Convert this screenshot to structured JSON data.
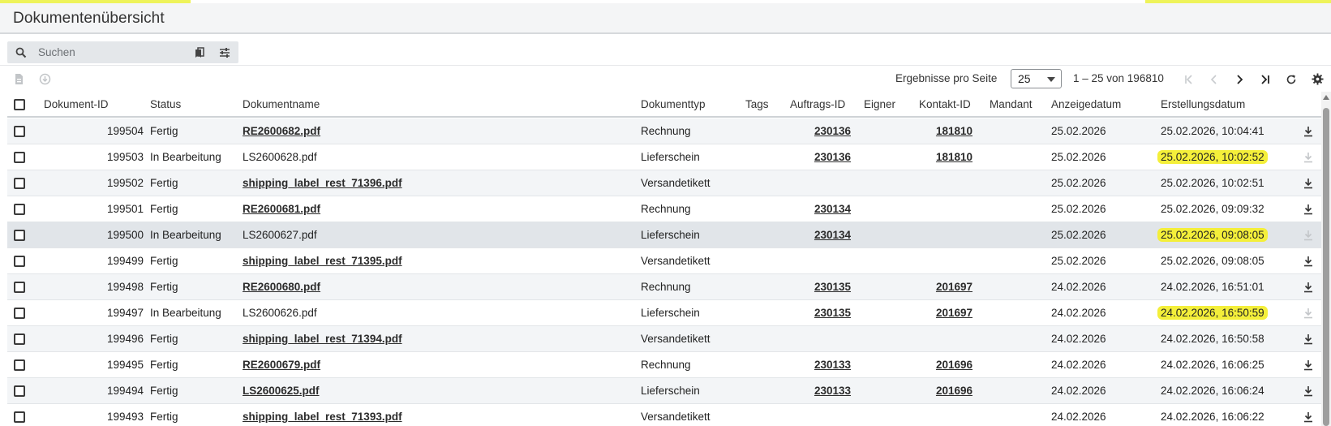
{
  "app": {
    "title": "Dokumentenübersicht",
    "accent_color": "#eef35a"
  },
  "search": {
    "placeholder": "Suchen"
  },
  "toolbar": {
    "icons": [
      "document-icon",
      "circle-arrow-icon",
      "search-icon",
      "bookmarks-icon",
      "filter-settings-icon"
    ]
  },
  "pager": {
    "per_page_label": "Ergebnisse pro Seite",
    "per_page_value": "25",
    "range": "1 – 25 von 196810"
  },
  "table": {
    "headers": {
      "id": "Dokument-ID",
      "status": "Status",
      "name": "Dokumentname",
      "type": "Dokumenttyp",
      "tags": "Tags",
      "order": "Auftrags-ID",
      "owner": "Eigner",
      "contact": "Kontakt-ID",
      "client": "Mandant",
      "display_date": "Anzeigedatum",
      "created": "Erstellungsdatum"
    },
    "rows": [
      {
        "id": "199504",
        "status": "Fertig",
        "name": "RE2600682.pdf",
        "name_link": true,
        "type": "Rechnung",
        "order": "230136",
        "contact": "181810",
        "display_date": "25.02.2026",
        "created": "25.02.2026, 10:04:41",
        "highlight": false,
        "download_enabled": true
      },
      {
        "id": "199503",
        "status": "In Bearbeitung",
        "name": "LS2600628.pdf",
        "name_link": false,
        "type": "Lieferschein",
        "order": "230136",
        "contact": "181810",
        "display_date": "25.02.2026",
        "created": "25.02.2026, 10:02:52",
        "highlight": true,
        "download_enabled": false
      },
      {
        "id": "199502",
        "status": "Fertig",
        "name": "shipping_label_rest_71396.pdf",
        "name_link": true,
        "type": "Versandetikett",
        "order": "",
        "contact": "",
        "display_date": "25.02.2026",
        "created": "25.02.2026, 10:02:51",
        "highlight": false,
        "download_enabled": true
      },
      {
        "id": "199501",
        "status": "Fertig",
        "name": "RE2600681.pdf",
        "name_link": true,
        "type": "Rechnung",
        "order": "230134",
        "contact": "",
        "display_date": "25.02.2026",
        "created": "25.02.2026, 09:09:32",
        "highlight": false,
        "download_enabled": true
      },
      {
        "id": "199500",
        "status": "In Bearbeitung",
        "name": "LS2600627.pdf",
        "name_link": false,
        "type": "Lieferschein",
        "order": "230134",
        "contact": "",
        "display_date": "25.02.2026",
        "created": "25.02.2026, 09:08:05",
        "highlight": true,
        "download_enabled": false
      },
      {
        "id": "199499",
        "status": "Fertig",
        "name": "shipping_label_rest_71395.pdf",
        "name_link": true,
        "type": "Versandetikett",
        "order": "",
        "contact": "",
        "display_date": "25.02.2026",
        "created": "25.02.2026, 09:08:05",
        "highlight": false,
        "download_enabled": true
      },
      {
        "id": "199498",
        "status": "Fertig",
        "name": "RE2600680.pdf",
        "name_link": true,
        "type": "Rechnung",
        "order": "230135",
        "contact": "201697",
        "display_date": "24.02.2026",
        "created": "24.02.2026, 16:51:01",
        "highlight": false,
        "download_enabled": true
      },
      {
        "id": "199497",
        "status": "In Bearbeitung",
        "name": "LS2600626.pdf",
        "name_link": false,
        "type": "Lieferschein",
        "order": "230135",
        "contact": "201697",
        "display_date": "24.02.2026",
        "created": "24.02.2026, 16:50:59",
        "highlight": true,
        "download_enabled": false
      },
      {
        "id": "199496",
        "status": "Fertig",
        "name": "shipping_label_rest_71394.pdf",
        "name_link": true,
        "type": "Versandetikett",
        "order": "",
        "contact": "",
        "display_date": "24.02.2026",
        "created": "24.02.2026, 16:50:58",
        "highlight": false,
        "download_enabled": true
      },
      {
        "id": "199495",
        "status": "Fertig",
        "name": "RE2600679.pdf",
        "name_link": true,
        "type": "Rechnung",
        "order": "230133",
        "contact": "201696",
        "display_date": "24.02.2026",
        "created": "24.02.2026, 16:06:25",
        "highlight": false,
        "download_enabled": true
      },
      {
        "id": "199494",
        "status": "Fertig",
        "name": "LS2600625.pdf",
        "name_link": true,
        "type": "Lieferschein",
        "order": "230133",
        "contact": "201696",
        "display_date": "24.02.2026",
        "created": "24.02.2026, 16:06:24",
        "highlight": false,
        "download_enabled": true
      },
      {
        "id": "199493",
        "status": "Fertig",
        "name": "shipping_label_rest_71393.pdf",
        "name_link": true,
        "type": "Versandetikett",
        "order": "",
        "contact": "",
        "display_date": "24.02.2026",
        "created": "24.02.2026, 16:06:22",
        "highlight": false,
        "download_enabled": true
      }
    ],
    "hover_row": 4,
    "highlight_color": "#f4ef3a"
  }
}
